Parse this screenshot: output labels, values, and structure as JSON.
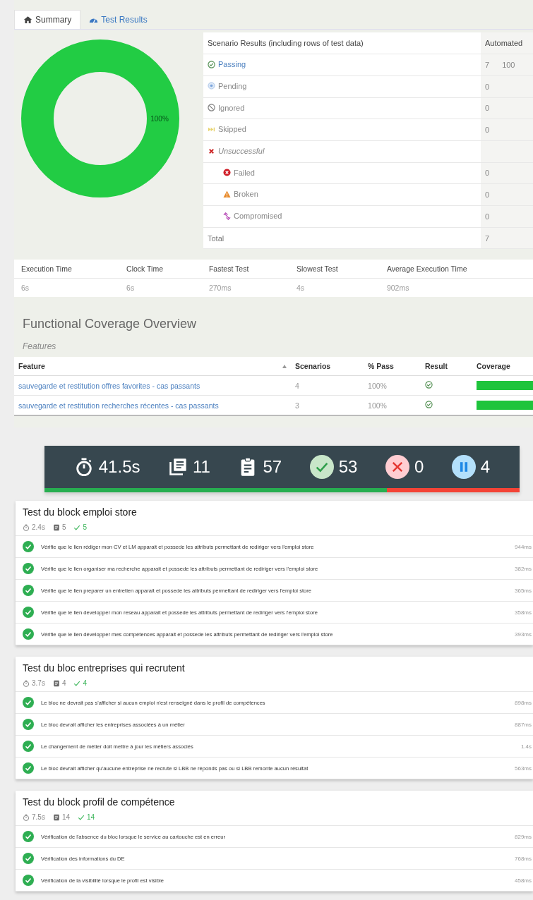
{
  "tabs": [
    {
      "label": "Summary",
      "kind": "home",
      "selected": true
    },
    {
      "label": "Test Results",
      "kind": "gauge",
      "selected": false
    }
  ],
  "summary_chart": {
    "label": "100%"
  },
  "scenario_results": {
    "columns": [
      "Scenario Results (including rows of test data)",
      "Automated"
    ],
    "rows": [
      {
        "label": "Passing",
        "kind": "passing",
        "count": "7",
        "percent": "100"
      },
      {
        "label": "Pending",
        "kind": "pending",
        "count": "0"
      },
      {
        "label": "Ignored",
        "kind": "ignored",
        "count": "0"
      },
      {
        "label": "Skipped",
        "kind": "skipped",
        "count": "0"
      },
      {
        "label": "Unsuccessful",
        "kind": "unsuccessful"
      },
      {
        "label": "Failed",
        "kind": "failed",
        "count": "0"
      },
      {
        "label": "Broken",
        "kind": "broken",
        "count": "0"
      },
      {
        "label": "Compromised",
        "kind": "compromised",
        "count": "0"
      },
      {
        "label": "Total",
        "kind": "total",
        "count": "7"
      }
    ]
  },
  "timing": {
    "columns": [
      "Execution Time",
      "Clock Time",
      "Fastest Test",
      "Slowest Test",
      "Average Execution Time"
    ],
    "values": [
      "6s",
      "6s",
      "270ms",
      "4s",
      "902ms"
    ]
  },
  "coverage": {
    "title": "Functional Coverage Overview",
    "subtitle": "Features",
    "columns": [
      "Feature",
      "Scenarios",
      "% Pass",
      "Result",
      "Coverage"
    ],
    "rows": [
      {
        "feature": "sauvegarde et restitution offres favorites - cas passants",
        "scenarios": "4",
        "pass": "100%",
        "kind": "passed",
        "level": 1
      },
      {
        "feature": "sauvegarde et restitution recherches récentes - cas passants",
        "scenarios": "3",
        "pass": "100%",
        "kind": "passed",
        "level": 1
      }
    ]
  },
  "summary_bar": {
    "items": [
      {
        "kind": "duration",
        "value": "41.5s"
      },
      {
        "kind": "features",
        "value": "11"
      },
      {
        "kind": "tests",
        "value": "57"
      },
      {
        "kind": "passed",
        "value": "53"
      },
      {
        "kind": "failed",
        "value": "0"
      },
      {
        "kind": "skipped",
        "value": "4"
      }
    ],
    "level": 0.72
  },
  "suites": [
    {
      "title": "Test du block emploi store",
      "duration": "2.4s",
      "tests": "5",
      "passed": "5",
      "cases": [
        {
          "name": "Vérifie que le lien rédiger mon CV et LM apparait et possede les attributs permettant de rediriger vers l'emploi store",
          "kind": "passed",
          "duration": "944ms"
        },
        {
          "name": "Vérifie que le lien organiser ma recherche apparait et possede les attributs permettant de rediriger vers l'emploi store",
          "kind": "passed",
          "duration": "382ms"
        },
        {
          "name": "Vérifie que le lien preparer un entretien apparait et possede les attributs permettant de rediriger vers l'emploi store",
          "kind": "passed",
          "duration": "365ms"
        },
        {
          "name": "Vérifie que le lien developper mon reseau apparait et possede les attributs permettant de rediriger vers l'emploi store",
          "kind": "passed",
          "duration": "358ms"
        },
        {
          "name": "Vérifie que le lien développer mes compétences apparait et possede les attributs permettant de rediriger vers l'emploi store",
          "kind": "passed",
          "duration": "393ms"
        }
      ]
    },
    {
      "title": "Test du bloc entreprises qui recrutent",
      "duration": "3.7s",
      "tests": "4",
      "passed": "4",
      "cases": [
        {
          "name": "Le bloc ne devrait pas s'afficher si aucun emploi n'est renseigné dans le profil de compétences",
          "kind": "passed",
          "duration": "898ms"
        },
        {
          "name": "Le bloc devrait afficher les entreprises associées à un métier",
          "kind": "passed",
          "duration": "887ms"
        },
        {
          "name": "Le changement de métier doit mettre à jour les métiers associés",
          "kind": "passed",
          "duration": "1.4s"
        },
        {
          "name": "Le bloc devrait afficher qu'aucune entreprise ne recrute si LBB ne réponds pas ou si LBB remonte aucun résultat",
          "kind": "passed",
          "duration": "563ms"
        }
      ]
    },
    {
      "title": "Test du block profil de compétence",
      "duration": "7.5s",
      "tests": "14",
      "passed": "14",
      "cases": [
        {
          "name": "Vérification de l'absence du bloc lorsque le service au cartouche est en erreur",
          "kind": "passed",
          "duration": "829ms"
        },
        {
          "name": "Vérification des informations du DE",
          "kind": "passed",
          "duration": "768ms"
        },
        {
          "name": "Vérification de la visibilité lorsque le profil est visible",
          "kind": "passed",
          "duration": "458ms"
        }
      ]
    }
  ]
}
